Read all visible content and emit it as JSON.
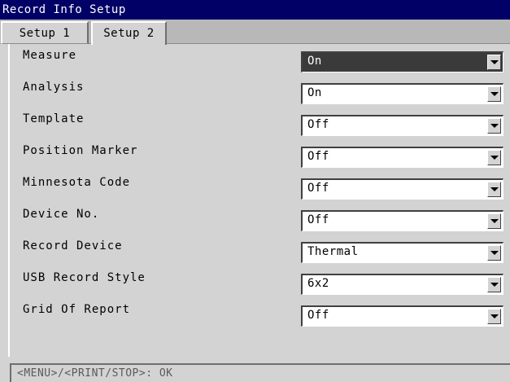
{
  "window": {
    "title": "Record Info Setup"
  },
  "tabs": [
    {
      "label": "Setup 1",
      "selected": false
    },
    {
      "label": "Setup 2",
      "selected": true
    }
  ],
  "settings": [
    {
      "label": "Measure",
      "value": "On",
      "focused": true
    },
    {
      "label": "Analysis",
      "value": "On",
      "focused": false
    },
    {
      "label": "Template",
      "value": "Off",
      "focused": false
    },
    {
      "label": "Position Marker",
      "value": "Off",
      "focused": false
    },
    {
      "label": "Minnesota Code",
      "value": "Off",
      "focused": false
    },
    {
      "label": "Device No.",
      "value": "Off",
      "focused": false
    },
    {
      "label": "Record Device",
      "value": "Thermal",
      "focused": false
    },
    {
      "label": "USB Record Style",
      "value": "6x2",
      "focused": false
    },
    {
      "label": "Grid Of Report",
      "value": "Off",
      "focused": false
    }
  ],
  "status": {
    "hint": "<MENU>/<PRINT/STOP>: OK"
  },
  "colors": {
    "title_bg": "#000066",
    "focused_field_bg": "#3a3a3a",
    "panel_bg": "#d3d3d3"
  }
}
